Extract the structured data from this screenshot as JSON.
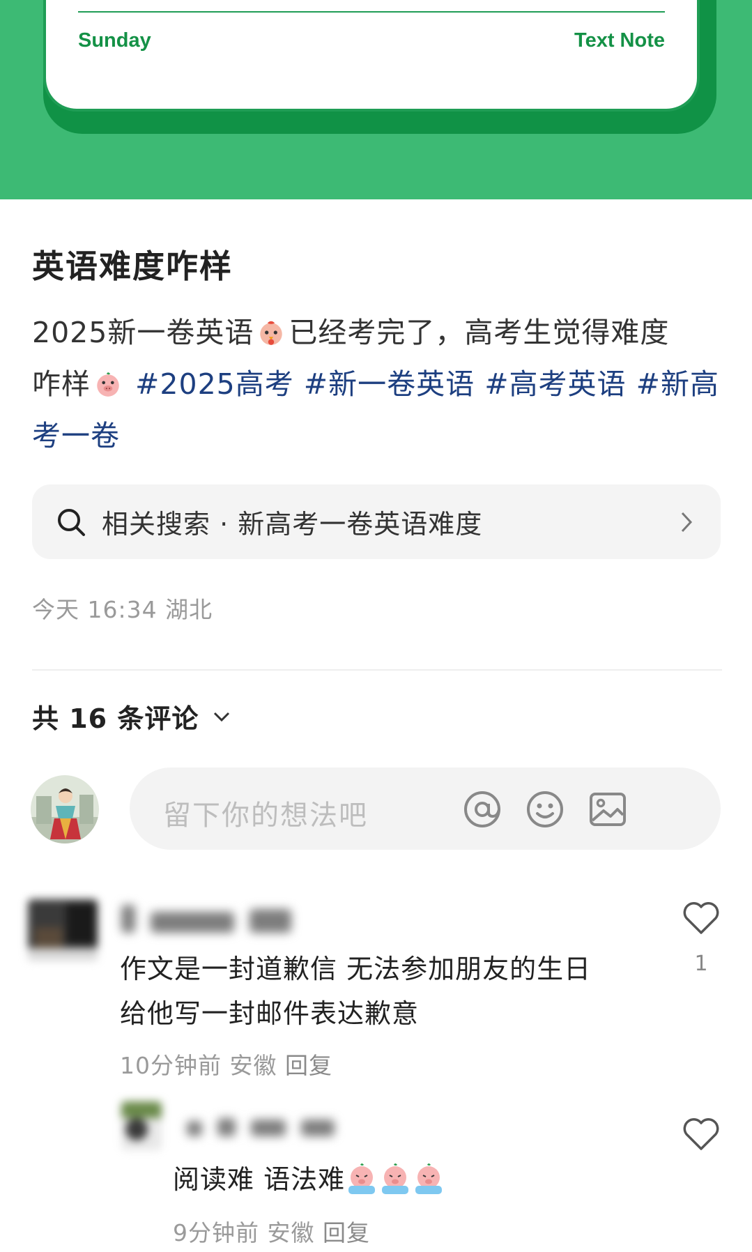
{
  "card": {
    "left_label": "Sunday",
    "right_label": "Text Note"
  },
  "post": {
    "title": "英语难度咋样",
    "body_segments": {
      "s1": "2025新一卷英语",
      "s2": "已经考完了，高考生觉得难度",
      "s3": "咋样",
      "tag1": "#2025高考",
      "tag2": "#新一卷英语",
      "tag3": "#高考英语",
      "tag4": "#新高考一卷"
    },
    "emoji_1": "chicken-emoji-icon",
    "emoji_2": "pig-emoji-icon"
  },
  "related_search": {
    "text": "相关搜索 · 新高考一卷英语难度",
    "icon": "search-icon"
  },
  "post_meta": "今天 16:34 湖北",
  "comments_header": "共 16 条评论",
  "comment_input": {
    "placeholder": "留下你的想法吧",
    "icons": [
      "at-icon",
      "emoji-icon",
      "image-icon"
    ]
  },
  "comments": [
    {
      "text_line1": "作文是一封道歉信 无法参加朋友的生日",
      "text_line2": "给他写一封邮件表达歉意",
      "time": "10分钟前",
      "location": "安徽",
      "reply_label": "回复",
      "likes": "1"
    },
    {
      "text": "阅读难 语法难",
      "time": "9分钟前",
      "location": "安徽",
      "reply_label": "回复",
      "emoji": "crying-pig-emoji-icon"
    }
  ],
  "colors": {
    "brand_green": "#3dba74",
    "dark_green": "#109246",
    "tag_blue": "#1d3f80"
  }
}
